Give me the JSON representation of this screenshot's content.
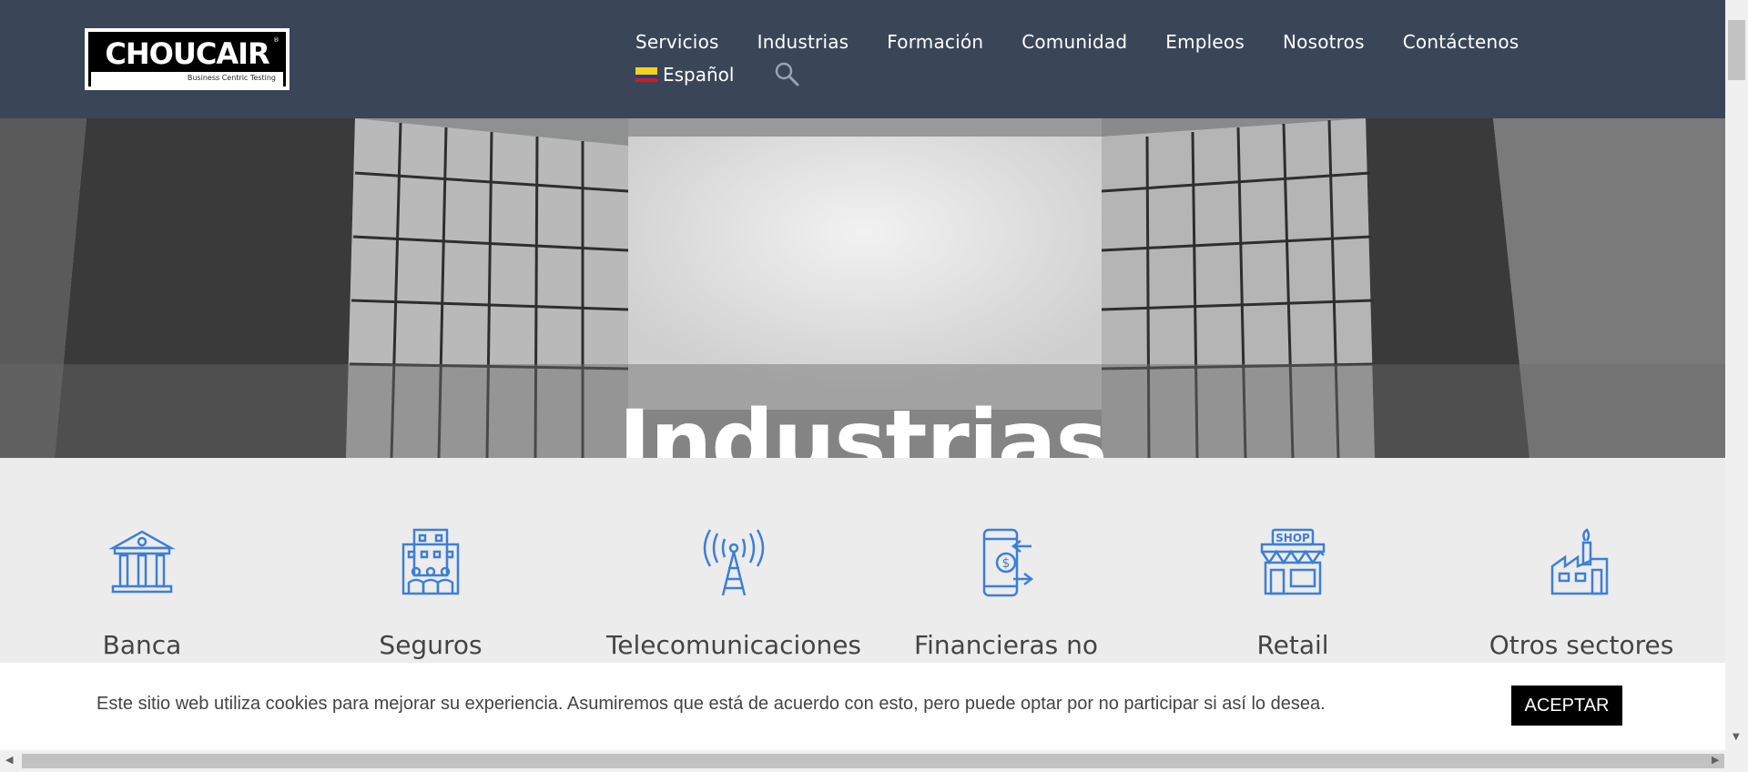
{
  "header": {
    "logo_text": "CHOUCAIR",
    "logo_tagline": "Business Centric Testing",
    "nav": [
      "Servicios",
      "Industrias",
      "Formación",
      "Comunidad",
      "Empleos",
      "Nosotros",
      "Contáctenos"
    ],
    "language": "Español"
  },
  "hero": {
    "title": "Industrias"
  },
  "industries": {
    "items": [
      {
        "label": "Banca",
        "icon": "bank-icon"
      },
      {
        "label": "Seguros",
        "icon": "insurance-building-icon"
      },
      {
        "label": "Telecomunicaciones",
        "icon": "antenna-tower-icon"
      },
      {
        "label": "Financieras no",
        "icon": "mobile-payment-icon"
      },
      {
        "label": "Retail",
        "icon": "shop-icon"
      },
      {
        "label": "Otros sectores",
        "icon": "factory-icon"
      }
    ],
    "icon_color": "#3d7fd6"
  },
  "cookie": {
    "text": "Este sitio web utiliza cookies para mejorar su experiencia. Asumiremos que está de acuerdo con esto, pero puede optar por no participar si así lo desea.",
    "accept": "ACEPTAR"
  },
  "colors": {
    "header_bg": "#3a4658",
    "page_bg": "#ececec"
  }
}
